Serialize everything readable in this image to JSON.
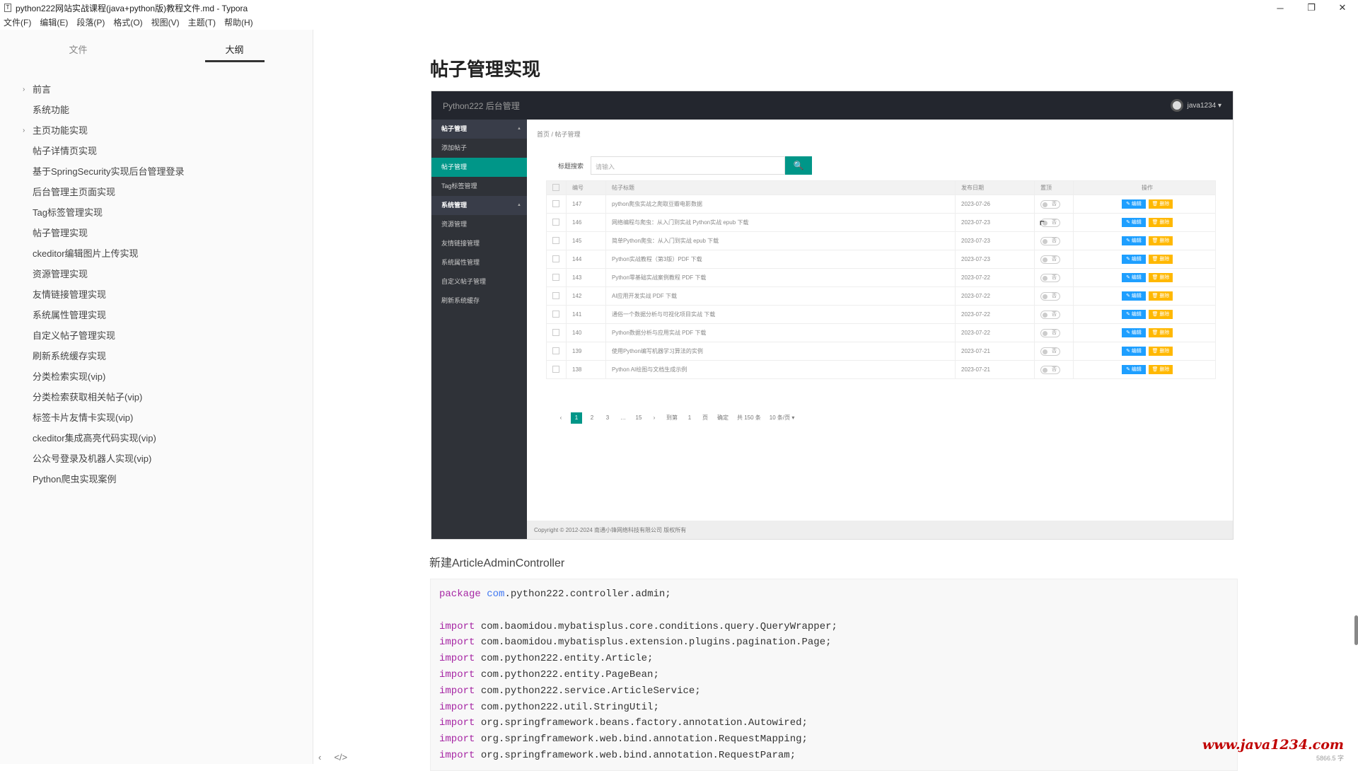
{
  "window": {
    "title": "python222网站实战课程(java+python版)教程文件.md - Typora",
    "minimize_glyph": "─",
    "restore_glyph": "❐",
    "close_glyph": "✕"
  },
  "menu": [
    "文件(F)",
    "编辑(E)",
    "段落(P)",
    "格式(O)",
    "视图(V)",
    "主题(T)",
    "帮助(H)"
  ],
  "sidebar": {
    "tabs": [
      "文件",
      "大纲"
    ],
    "active_tab": 1,
    "outline": [
      {
        "label": "前言",
        "caret": "›"
      },
      {
        "label": "系统功能",
        "caret": ""
      },
      {
        "label": "主页功能实现",
        "caret": "›"
      },
      {
        "label": "帖子详情页实现",
        "caret": ""
      },
      {
        "label": "基于SpringSecurity实现后台管理登录",
        "caret": ""
      },
      {
        "label": "后台管理主页面实现",
        "caret": ""
      },
      {
        "label": "Tag标签管理实现",
        "caret": ""
      },
      {
        "label": "帖子管理实现",
        "caret": ""
      },
      {
        "label": "ckeditor编辑图片上传实现",
        "caret": ""
      },
      {
        "label": "资源管理实现",
        "caret": ""
      },
      {
        "label": "友情链接管理实现",
        "caret": ""
      },
      {
        "label": "系统属性管理实现",
        "caret": ""
      },
      {
        "label": "自定义帖子管理实现",
        "caret": ""
      },
      {
        "label": "刷新系统缓存实现",
        "caret": ""
      },
      {
        "label": "分类检索实现(vip)",
        "caret": ""
      },
      {
        "label": "分类检索获取相关帖子(vip)",
        "caret": ""
      },
      {
        "label": "标签卡片友情卡实现(vip)",
        "caret": ""
      },
      {
        "label": "ckeditor集成高亮代码实现(vip)",
        "caret": ""
      },
      {
        "label": "公众号登录及机器人实现(vip)",
        "caret": ""
      },
      {
        "label": "Python爬虫实现案例",
        "caret": ""
      }
    ],
    "bottom_icons": [
      "‹",
      "</>"
    ]
  },
  "doc": {
    "heading": "帖子管理实现",
    "paragraph": "新建ArticleAdminController"
  },
  "admin": {
    "brand": "Python222 后台管理",
    "user": "java1234 ▾",
    "nav": [
      {
        "label": "帖子管理",
        "type": "group"
      },
      {
        "label": "添加帖子",
        "type": "item"
      },
      {
        "label": "帖子管理",
        "type": "active"
      },
      {
        "label": "Tag标签管理",
        "type": "item"
      },
      {
        "label": "系统管理",
        "type": "group"
      },
      {
        "label": "资源管理",
        "type": "item"
      },
      {
        "label": "友情链接管理",
        "type": "item"
      },
      {
        "label": "系统属性管理",
        "type": "item"
      },
      {
        "label": "自定义帖子管理",
        "type": "item"
      },
      {
        "label": "刷新系统缓存",
        "type": "item"
      }
    ],
    "breadcrumb": "首页 / 帖子管理",
    "search_label": "标题搜索",
    "search_placeholder": "请输入",
    "search_icon": "🔍",
    "columns": [
      "",
      "编号",
      "帖子标题",
      "发布日期",
      "置顶",
      "操作"
    ],
    "rows": [
      {
        "id": "147",
        "title": "python爬虫实战之爬取豆瓣电影数据",
        "date": "2023-07-26",
        "top": "否"
      },
      {
        "id": "146",
        "title": "网络编程与爬虫：从入门到实战 Python实战 epub 下载",
        "date": "2023-07-23",
        "top": "否"
      },
      {
        "id": "145",
        "title": "简单Python爬虫：从入门到实战 epub 下载",
        "date": "2023-07-23",
        "top": "否"
      },
      {
        "id": "144",
        "title": "Python实战教程（第3版）PDF 下载",
        "date": "2023-07-23",
        "top": "否"
      },
      {
        "id": "143",
        "title": "Python零基础实战案例教程 PDF 下载",
        "date": "2023-07-22",
        "top": "否"
      },
      {
        "id": "142",
        "title": "AI应用开发实战 PDF 下载",
        "date": "2023-07-22",
        "top": "否"
      },
      {
        "id": "141",
        "title": "通俗一个数据分析与可视化项目实战 下载",
        "date": "2023-07-22",
        "top": "否"
      },
      {
        "id": "140",
        "title": "Python数据分析与应用实战 PDF 下载",
        "date": "2023-07-22",
        "top": "否"
      },
      {
        "id": "139",
        "title": "使用Python编写机器学习算法的实例",
        "date": "2023-07-21",
        "top": "否"
      },
      {
        "id": "138",
        "title": "Python AI绘图与文档生成示例",
        "date": "2023-07-21",
        "top": "否"
      }
    ],
    "edit_label": "✎ 编辑",
    "delete_label": "🗑 删除",
    "pager": [
      "‹",
      "1",
      "2",
      "3",
      "…",
      "15",
      "›",
      "到第",
      "1",
      "页",
      "确定",
      "共 150 条",
      "10 条/页 ▾"
    ],
    "footer": "Copyright © 2012-2024 南通小锋网络科技有限公司 版权所有"
  },
  "code": [
    [
      {
        "t": "package",
        "c": "kw"
      },
      {
        "t": " "
      },
      {
        "t": "com",
        "c": "pkg"
      },
      {
        "t": ".python222.controller.admin;"
      }
    ],
    [],
    [
      {
        "t": "import",
        "c": "kw"
      },
      {
        "t": " com.baomidou.mybatisplus.core.conditions.query.QueryWrapper;"
      }
    ],
    [
      {
        "t": "import",
        "c": "kw"
      },
      {
        "t": " com.baomidou.mybatisplus.extension.plugins.pagination.Page;"
      }
    ],
    [
      {
        "t": "import",
        "c": "kw"
      },
      {
        "t": " com.python222.entity.Article;"
      }
    ],
    [
      {
        "t": "import",
        "c": "kw"
      },
      {
        "t": " com.python222.entity.PageBean;"
      }
    ],
    [
      {
        "t": "import",
        "c": "kw"
      },
      {
        "t": " com.python222.service.ArticleService;"
      }
    ],
    [
      {
        "t": "import",
        "c": "kw"
      },
      {
        "t": " com.python222.util.StringUtil;"
      }
    ],
    [
      {
        "t": "import",
        "c": "kw"
      },
      {
        "t": " org.springframework.beans.factory.annotation.Autowired;"
      }
    ],
    [
      {
        "t": "import",
        "c": "kw"
      },
      {
        "t": " org.springframework.web.bind.annotation.RequestMapping;"
      }
    ],
    [
      {
        "t": "import",
        "c": "kw"
      },
      {
        "t": " org.springframework.web.bind.annotation.RequestParam;"
      }
    ]
  ],
  "watermark": "www.java1234.com",
  "watermark_small": "5866.5 字"
}
